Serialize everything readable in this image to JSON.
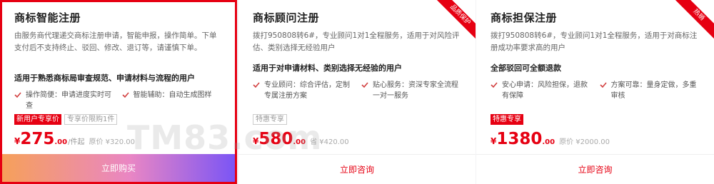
{
  "cards": [
    {
      "title": "商标智能注册",
      "desc": "由服务商代理递交商标注册申请，智能申报，操作简单。下单支付后不支持终止、驳回、修改、退订等，请谨慎下单。",
      "headline": "适用于熟悉商标局审查规范、申请材料与流程的用户",
      "features": [
        "操作简便：申请进度实时可查",
        "智能辅助：自动生成图样"
      ],
      "tags": [
        "新用户专享价",
        "专享价限购1件"
      ],
      "price_int": "275",
      "price_dec": ".00",
      "unit": "/件起",
      "original": "原价 ¥320.00",
      "cta": "立即购买",
      "ribbon": ""
    },
    {
      "title": "商标顾问注册",
      "desc": "拨打950808转6#，专业顾问1对1全程服务，适用于对风险评估、类别选择无经验用户",
      "headline": "适用于对申请材料、类别选择无经验的用户",
      "features": [
        "专业顾问：综合评估，定制专属注册方案",
        "贴心服务：资深专家全流程一对一服务"
      ],
      "tags": [
        "特惠专享"
      ],
      "price_int": "580",
      "price_dec": ".00",
      "unit": "",
      "original": "省 ¥420.00",
      "cta": "立即咨询",
      "ribbon": "品质保护"
    },
    {
      "title": "商标担保注册",
      "desc": "拨打950808转6#，专业顾问1对1全程服务，适用于对商标注册成功率要求高的用户",
      "headline": "全部驳回可全额退款",
      "features": [
        "安心申请：风险担保，退款有保障",
        "方案可靠：量身定做，多重审核"
      ],
      "tags": [
        "特惠专享"
      ],
      "price_int": "1380",
      "price_dec": ".00",
      "unit": "",
      "original": "原价 ¥2000.00",
      "cta": "立即咨询",
      "ribbon": "热销"
    }
  ],
  "currency": "¥",
  "watermark": "TM83.com",
  "colors": {
    "accent": "#e60012",
    "check": "#d23f3f"
  },
  "icons": {
    "feature": "check-icon"
  }
}
